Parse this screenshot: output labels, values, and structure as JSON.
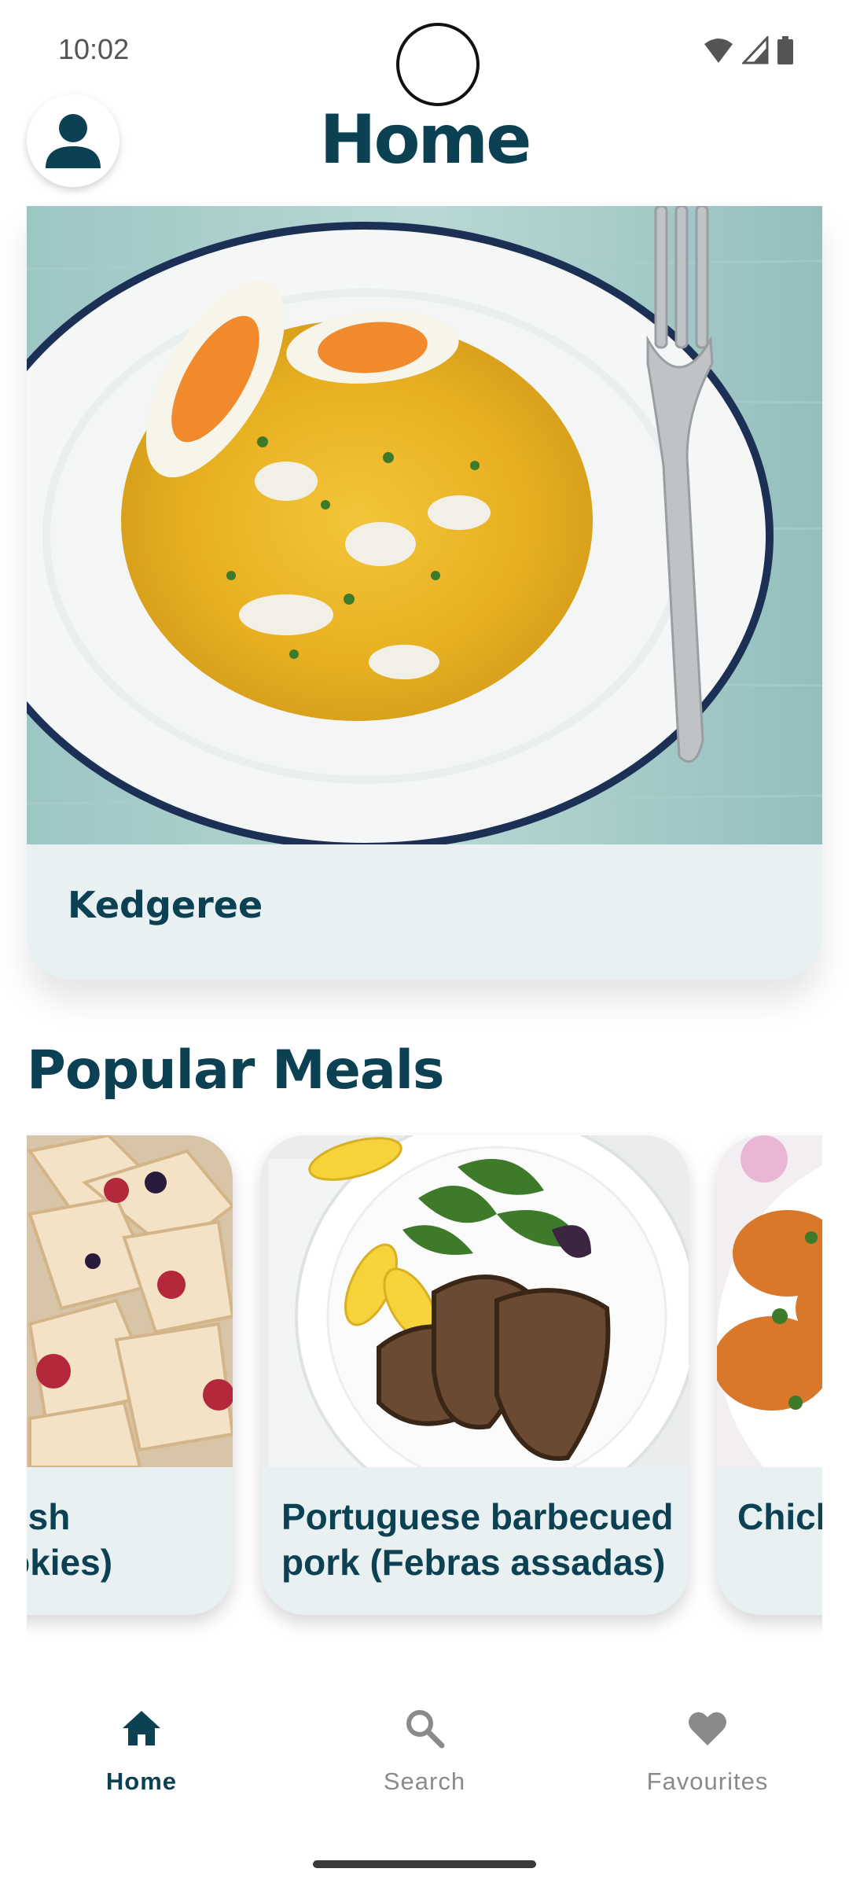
{
  "status_bar": {
    "time": "10:02",
    "icons": [
      "wifi-icon",
      "signal-icon",
      "battery-icon"
    ]
  },
  "header": {
    "title": "Home",
    "avatar_icon": "person-icon"
  },
  "featured": {
    "title": "Kedgeree"
  },
  "popular": {
    "title": "Popular Meals",
    "items": [
      {
        "label_line1": "olish",
        "label_line2": "ookies)"
      },
      {
        "label_line1": "Portuguese barbecued",
        "label_line2": "pork (Febras assadas)"
      },
      {
        "label_line1": "Chick",
        "label_line2": ""
      }
    ]
  },
  "bottom_nav": {
    "items": [
      {
        "label": "Home",
        "icon": "home-icon",
        "active": true
      },
      {
        "label": "Search",
        "icon": "search-icon",
        "active": false
      },
      {
        "label": "Favourites",
        "icon": "heart-icon",
        "active": false
      }
    ]
  },
  "colors": {
    "primary": "#0b4152",
    "card_bg": "#e8f0f2",
    "inactive": "#8a8a8a"
  }
}
